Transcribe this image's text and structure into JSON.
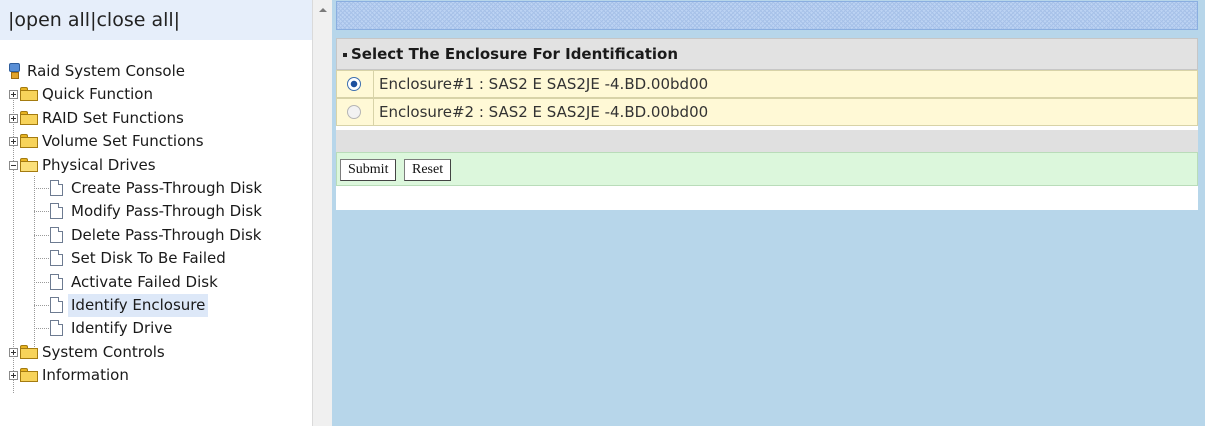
{
  "tree_header": {
    "bar1": "|",
    "open_all": "open all",
    "bar2": "|",
    "close_all": "close all",
    "bar3": "|"
  },
  "tree": {
    "root": "Raid System Console",
    "quick_function": "Quick Function",
    "raid_set_functions": "RAID Set Functions",
    "volume_set_functions": "Volume Set Functions",
    "physical_drives": "Physical Drives",
    "physical_items": [
      "Create Pass-Through Disk",
      "Modify Pass-Through Disk",
      "Delete Pass-Through Disk",
      "Set Disk To Be Failed",
      "Activate Failed Disk",
      "Identify Enclosure",
      "Identify Drive"
    ],
    "selected_item": "Identify Enclosure",
    "system_controls": "System Controls",
    "information": "Information"
  },
  "panel": {
    "title": "Select The Enclosure For Identification",
    "enclosures": [
      {
        "label": "Enclosure#1 : SAS2 E SAS2JE -4.BD.00bd00",
        "selected": true
      },
      {
        "label": "Enclosure#2 : SAS2 E SAS2JE -4.BD.00bd00",
        "selected": false
      }
    ],
    "submit_label": "Submit",
    "reset_label": "Reset"
  },
  "colors": {
    "content_background": "#b7d6ea",
    "header_strip": "#bcd3f3",
    "enclosure_row": "#fff9d6",
    "button_row": "#dcf7dc"
  },
  "icons": {
    "root": "raid-console-icon",
    "folder": "folder-icon",
    "folder_open": "folder-open-icon",
    "page": "page-icon",
    "expand": "plus-box-icon",
    "collapse": "minus-box-icon"
  }
}
